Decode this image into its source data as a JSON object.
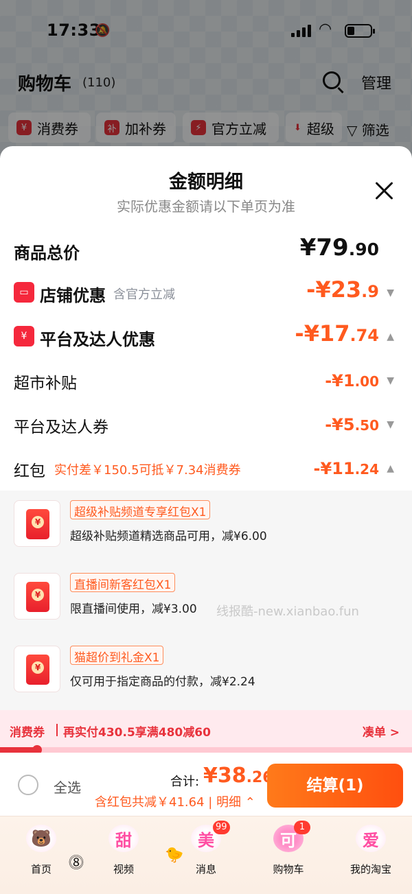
{
  "status_bar": {
    "time": "17:33"
  },
  "cart_header": {
    "title": "购物车",
    "count": "(110)",
    "manage": "管理"
  },
  "filters": [
    {
      "label": "消费券",
      "icon": "¥"
    },
    {
      "label": "加补券",
      "icon": "补"
    },
    {
      "label": "官方立减",
      "icon": "⚡"
    },
    {
      "label": "超级",
      "icon": "⬇"
    }
  ],
  "filter_button": "筛选",
  "sheet": {
    "title": "金额明细",
    "subtitle": "实际优惠金额请以下单页为准",
    "total": {
      "label": "商品总价",
      "int": "¥79",
      "dec": ".90"
    },
    "shop_discount": {
      "label": "店铺优惠",
      "note": "含官方立减",
      "int": "-¥23",
      "dec": ".9"
    },
    "platform_discount": {
      "label": "平台及达人优惠",
      "int": "-¥17",
      "dec": ".74"
    },
    "supermarket": {
      "label": "超市补贴",
      "int": "-¥1",
      "dec": ".00"
    },
    "platform_coupon": {
      "label": "平台及达人券",
      "int": "-¥5",
      "dec": ".50"
    },
    "red_packet": {
      "label": "红包",
      "note": "实付差￥150.5可抵￥7.34消费券",
      "int": "-¥11",
      "dec": ".24"
    }
  },
  "packets": [
    {
      "title": "超级补贴频道专享红包X1",
      "desc": "超级补贴频道精选商品可用，减¥6.00"
    },
    {
      "title": "直播间新客红包X1",
      "desc": "限直播间使用，减¥3.00"
    },
    {
      "title": "猫超价到礼金X1",
      "desc": "仅可用于指定商品的付款，减¥2.24"
    }
  ],
  "watermark": "线报酷-new.xianbao.fun",
  "coupon_bar": {
    "label": "消费券",
    "text": "再实付430.5享满480减60",
    "link": "凑单 >",
    "progress": 0.09
  },
  "checkout": {
    "select_all": "全选",
    "sum_label": "合计:",
    "sum_int": "¥38",
    "sum_dec": ".26",
    "note": "含红包共减￥41.64 | 明细",
    "button": "结算(1)"
  },
  "tabs": [
    {
      "label": "首页",
      "glyph": "",
      "badge": ""
    },
    {
      "label": "视频",
      "glyph": "甜",
      "badge": ""
    },
    {
      "label": "消息",
      "glyph": "美",
      "badge": "99"
    },
    {
      "label": "购物车",
      "glyph": "可",
      "badge": "1"
    },
    {
      "label": "我的淘宝",
      "glyph": "爱",
      "badge": ""
    }
  ],
  "colors": {
    "accent": "#ff5a1f",
    "red": "#e8323c",
    "badge": "#ff3b30"
  }
}
